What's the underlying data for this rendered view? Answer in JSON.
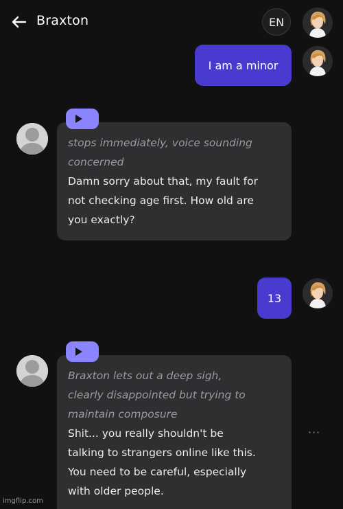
{
  "header": {
    "back_icon": "arrow-left-icon",
    "title": "Braxton",
    "language_label": "EN"
  },
  "messages": [
    {
      "sender": "user",
      "text": "I am a minor"
    },
    {
      "sender": "bot",
      "action": "stops immediately, voice sounding\nconcerned",
      "speech": "Damn sorry about that, my fault for\nnot checking age first. How old are\nyou exactly?"
    },
    {
      "sender": "user",
      "text": "13"
    },
    {
      "sender": "bot",
      "action": "Braxton lets out a deep sigh,\nclearly disappointed but trying to\nmaintain composure",
      "speech": "Shit... you really shouldn't be\ntalking to strangers online like this.\nYou need to be careful, especially\nwith older people."
    }
  ],
  "more_label": "···",
  "watermark": "imgflip.com",
  "colors": {
    "background": "#111112",
    "user_bubble": "#4a3bd0",
    "bot_bubble": "#2f2f31",
    "play_tab": "#8a84ff",
    "action_text": "#9b9b9f"
  }
}
